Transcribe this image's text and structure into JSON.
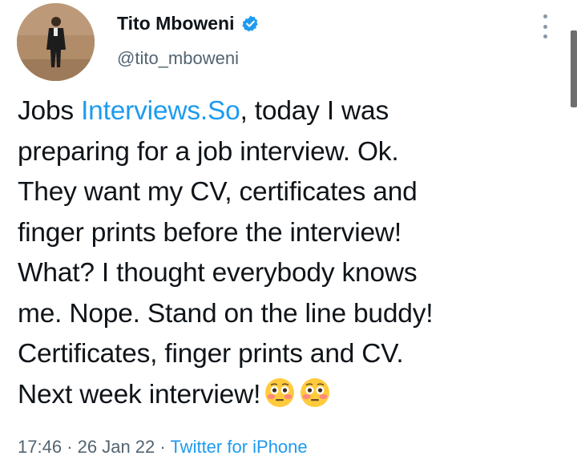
{
  "user": {
    "display_name": "Tito Mboweni",
    "handle": "@tito_mboweni",
    "verified_icon": "verified-badge-icon",
    "avatar_icon": "profile-avatar"
  },
  "menu": {
    "icon": "more-vertical-icon"
  },
  "tweet": {
    "line1_prefix": "Jobs ",
    "line1_link": "Interviews.So",
    "line1_suffix": ", today I was",
    "lines": [
      "preparing for a job interview. Ok.",
      "They want my CV, certificates and",
      "finger prints before the interview!",
      "What? I thought everybody knows",
      "me. Nope. Stand on the line buddy!",
      "Certificates, finger prints and CV."
    ],
    "last_line": "Next week interview!",
    "emojis": [
      "flushed-face-emoji",
      "flushed-face-emoji"
    ]
  },
  "meta": {
    "time": "17:46",
    "date": "26 Jan 22",
    "separator": "·",
    "source": "Twitter for iPhone"
  },
  "colors": {
    "link": "#1d9bf0",
    "text": "#0f1419",
    "secondary": "#536471",
    "verified": "#1d9bf0"
  }
}
